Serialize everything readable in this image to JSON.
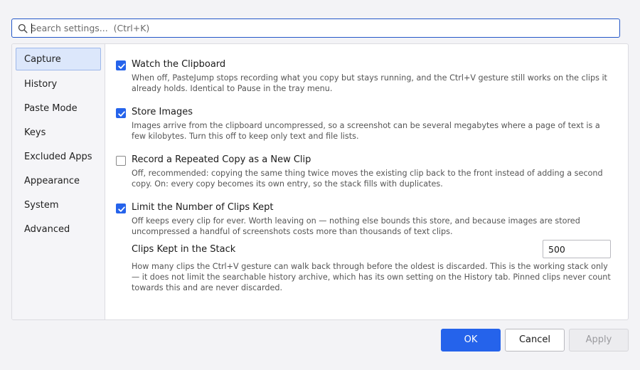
{
  "search": {
    "placeholder": "Search settings...  (Ctrl+K)",
    "icon": "search-icon"
  },
  "sidebar": {
    "items": [
      {
        "label": "Capture",
        "active": true
      },
      {
        "label": "History"
      },
      {
        "label": "Paste Mode"
      },
      {
        "label": "Keys"
      },
      {
        "label": "Excluded Apps"
      },
      {
        "label": "Appearance"
      },
      {
        "label": "System"
      },
      {
        "label": "Advanced"
      }
    ]
  },
  "options": [
    {
      "title": "Watch the Clipboard",
      "checked": true,
      "description": "When off, PasteJump stops recording what you copy but stays running, and the Ctrl+V gesture still works on the clips it already holds. Identical to Pause in the tray menu."
    },
    {
      "title": "Store Images",
      "checked": true,
      "description": "Images arrive from the clipboard uncompressed, so a screenshot can be several megabytes where a page of text is a few kilobytes. Turn this off to keep only text and file lists."
    },
    {
      "title": "Record a Repeated Copy as a New Clip",
      "checked": false,
      "description": "Off, recommended: copying the same thing twice moves the existing clip back to the front instead of adding a second copy. On: every copy becomes its own entry, so the stack fills with duplicates."
    },
    {
      "title": "Limit the Number of Clips Kept",
      "checked": true,
      "description": "Off keeps every clip for ever. Worth leaving on — nothing else bounds this store, and because images are stored uncompressed a handful of screenshots costs more than thousands of text clips."
    }
  ],
  "clips_kept": {
    "label": "Clips Kept in the Stack",
    "value": "500",
    "description": "How many clips the Ctrl+V gesture can walk back through before the oldest is discarded. This is the working stack only — it does not limit the searchable history archive, which has its own setting on the History tab. Pinned clips never count towards this and are never discarded."
  },
  "buttons": {
    "ok": "OK",
    "cancel": "Cancel",
    "apply": "Apply"
  },
  "colors": {
    "accent": "#2563eb",
    "focus_border": "#2357c8",
    "selected_nav": "#dce7fb"
  }
}
